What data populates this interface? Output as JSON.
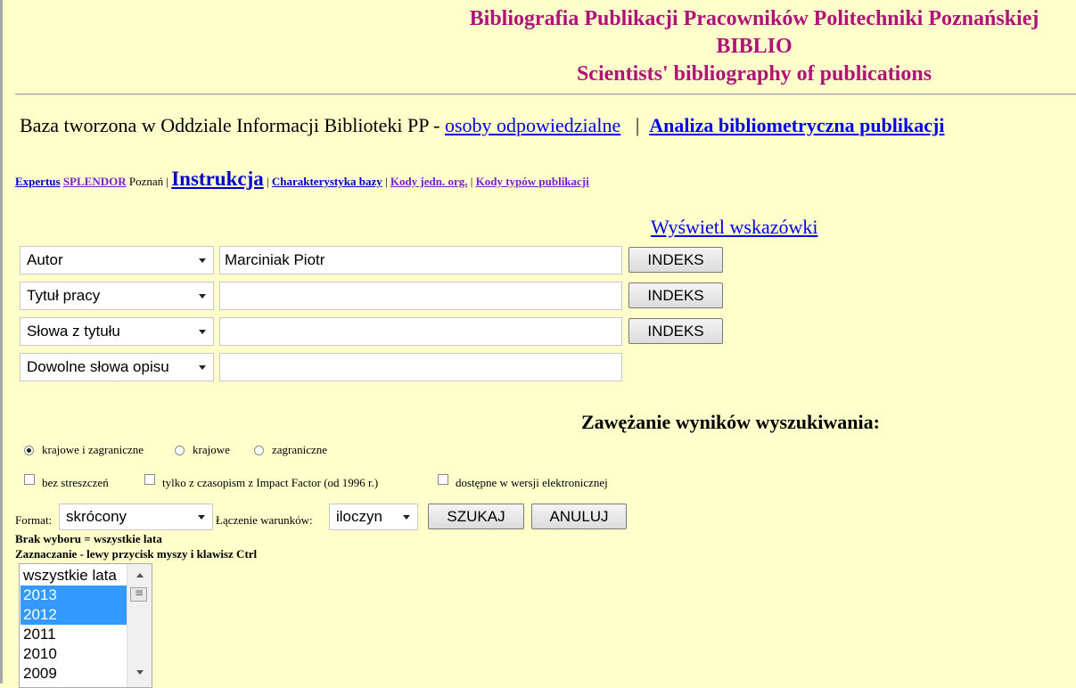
{
  "header": {
    "line1": "Bibliografia Publikacji Pracowników Politechniki Poznańskiej",
    "line2": "BIBLIO",
    "line3": "Scientists' bibliography of publications"
  },
  "intro": {
    "text": "Baza tworzona w Oddziale Informacji Biblioteki PP - ",
    "responsible_link": "osoby odpowiedzialne",
    "separator": "|",
    "analysis_link": "Analiza bibliometryczna publikacji"
  },
  "nav": {
    "expertus": "Expertus",
    "splendor": "SPLENDOR",
    "poznan": "Poznań |",
    "instrukcja": "Instrukcja",
    "sep1": "|",
    "charakterystyka": "Charakterystyka bazy",
    "sep2": "|",
    "kody_jedn": "Kody jedn. org.",
    "sep3": "|",
    "kody_typow": "Kody typów publikacji"
  },
  "hints_link": "Wyświetl wskazówki",
  "search_rows": [
    {
      "field": "Autor",
      "value": "Marciniak Piotr",
      "index_label": "INDEKS"
    },
    {
      "field": "Tytuł pracy",
      "value": "",
      "index_label": "INDEKS"
    },
    {
      "field": "Słowa z tytułu",
      "value": "",
      "index_label": "INDEKS"
    },
    {
      "field": "Dowolne słowa opisu",
      "value": ""
    }
  ],
  "narrowing": {
    "title": "Zawężanie wyników wyszukiwania:",
    "radios": [
      {
        "label": "krajowe i zagraniczne",
        "checked": true
      },
      {
        "label": "krajowe",
        "checked": false
      },
      {
        "label": "zagraniczne",
        "checked": false
      }
    ],
    "checkboxes": [
      {
        "label": "bez streszczeń",
        "checked": false
      },
      {
        "label": "tylko z czasopism z Impact Factor (od 1996 r.)",
        "checked": false
      },
      {
        "label": "dostępne w wersji elektronicznej",
        "checked": false
      }
    ]
  },
  "controls": {
    "format_label": "Format:",
    "format_value": "skrócony",
    "join_label": "Łączenie warunków:",
    "join_value": "iloczyn",
    "search_button": "SZUKAJ",
    "cancel_button": "ANULUJ"
  },
  "notes": {
    "no_selection": "Brak wyboru = wszystkie lata",
    "selection_hint": "Zaznaczanie - lewy przycisk myszy i klawisz Ctrl"
  },
  "years": {
    "items": [
      {
        "label": "wszystkie lata",
        "selected": false
      },
      {
        "label": "2013",
        "selected": true
      },
      {
        "label": "2012",
        "selected": true
      },
      {
        "label": "2011",
        "selected": false
      },
      {
        "label": "2010",
        "selected": false
      },
      {
        "label": "2009",
        "selected": false
      }
    ]
  }
}
